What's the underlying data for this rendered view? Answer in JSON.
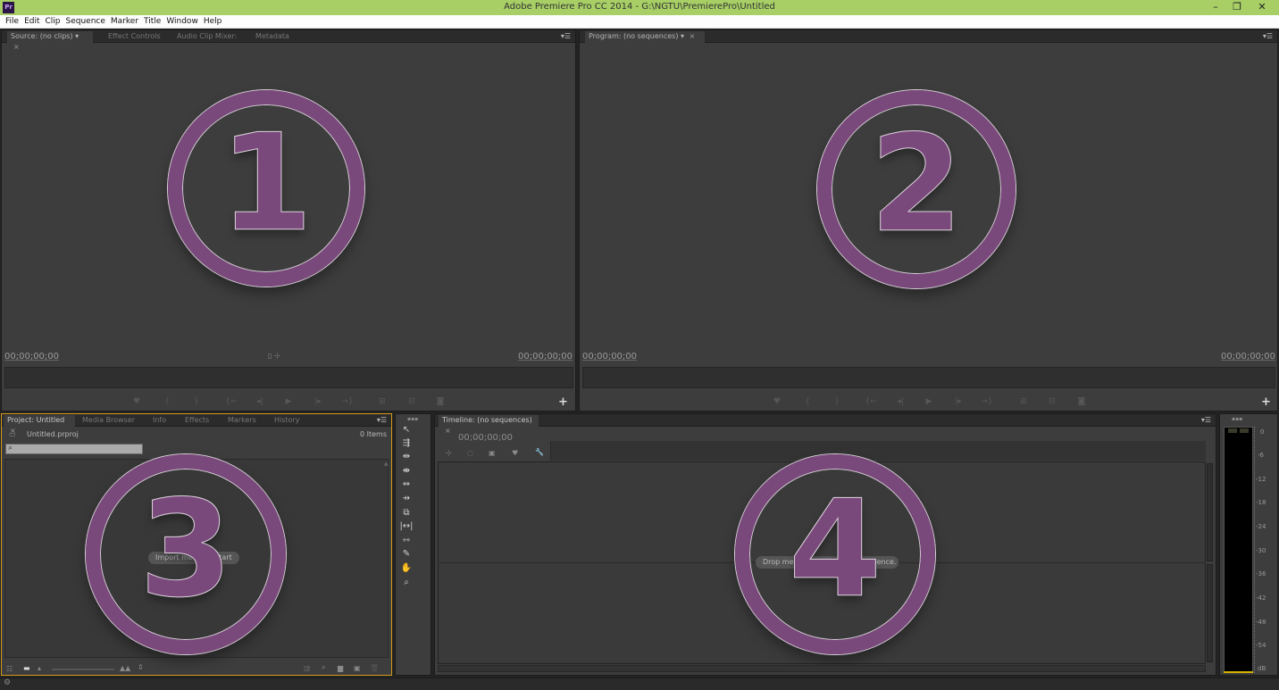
{
  "window": {
    "title": "Adobe Premiere Pro CC 2014 - G:\\NGTU\\PremierePro\\Untitled",
    "logo": "Pr",
    "minimize": "–",
    "restore": "❐",
    "close": "✕"
  },
  "menu": [
    "File",
    "Edit",
    "Clip",
    "Sequence",
    "Marker",
    "Title",
    "Window",
    "Help"
  ],
  "source_panel": {
    "tabs": [
      "Source: (no clips)",
      "Effect Controls",
      "Audio Clip Mixer:",
      "Metadata"
    ],
    "timecode_in": "00;00;00;00",
    "timecode_out": "00;00;00;00",
    "badge": "1"
  },
  "program_panel": {
    "tab": "Program: (no sequences)",
    "timecode_in": "00;00;00;00",
    "timecode_out": "00;00;00;00",
    "badge": "2"
  },
  "project_panel": {
    "tabs": [
      "Project: Untitled",
      "Media Browser",
      "Info",
      "Effects",
      "Markers",
      "History"
    ],
    "file": "Untitled.prproj",
    "items": "0 Items",
    "hint": "Import media to start",
    "badge": "3"
  },
  "timeline_panel": {
    "tab": "Timeline: (no sequences)",
    "timecode": "00;00;00;00",
    "hint": "Drop media here to create sequence.",
    "badge": "4"
  },
  "audio_meter": {
    "scale": [
      "0",
      "-6",
      "-12",
      "-18",
      "-24",
      "-30",
      "-36",
      "-42",
      "-48",
      "-54",
      "dB"
    ]
  },
  "colors": {
    "title_bar": "#a7cf65",
    "badge": "#7a497b",
    "panel": "#3d3d3d"
  }
}
